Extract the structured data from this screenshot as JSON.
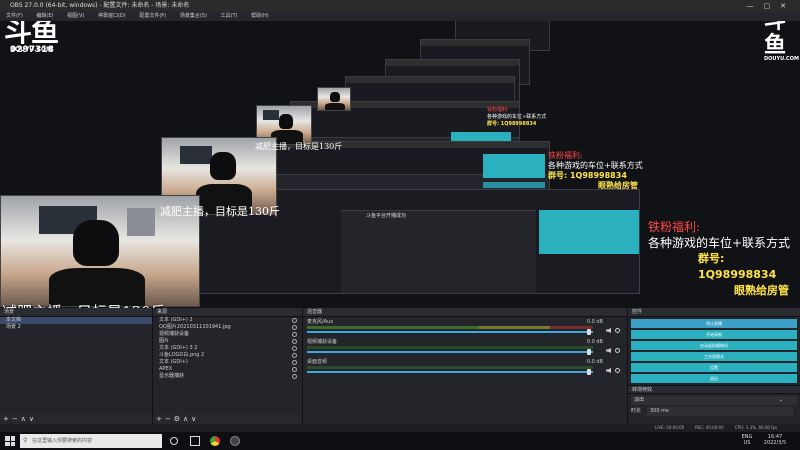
{
  "window": {
    "title": "OBS 27.0.0 (64-bit, windows) - 配置文件: 未命名 - 场景: 未命名"
  },
  "menu": [
    "文件(F)",
    "编辑(E)",
    "视图(V)",
    "停靠窗口(D)",
    "配置文件(P)",
    "场景集合(S)",
    "工具(T)",
    "帮助(H)"
  ],
  "overlay": {
    "logo_text": "斗鱼",
    "logo_sub": "DOUYU.COM",
    "room_id": "9297318",
    "fan_title": "铁粉福利:",
    "fan_desc": "各种游戏的车位+联系方式",
    "group_label": "群号: 1Q98998834",
    "group_sub": "眼熟给房管",
    "caption": "减肥主播，目标是130斤",
    "nested_toast": "斗鱼平台开播成功"
  },
  "scenes": {
    "header": "场景",
    "items": [
      "本文档",
      "场景 2"
    ]
  },
  "sources": {
    "header": "来源",
    "items": [
      {
        "label": "文本 (GDI+) 2"
      },
      {
        "label": "QQ图片20210311101941.jpg"
      },
      {
        "label": "视频捕获设备"
      },
      {
        "label": "图片"
      },
      {
        "label": "文本 (GDI+) 3 2"
      },
      {
        "label": "斗鱼LOGO白.png 2"
      },
      {
        "label": "文本 (GDI+)"
      },
      {
        "label": "APEX"
      },
      {
        "label": "显示器捕获"
      }
    ]
  },
  "mixer": {
    "header": "混音器",
    "channels": [
      {
        "name": "桌面音频",
        "db": "0.0 dB"
      },
      {
        "name": "视频捕获设备",
        "db": "0.0 dB"
      },
      {
        "name": "麦克风/Aux",
        "db": "0.0 dB"
      }
    ]
  },
  "controls": {
    "header": "控件",
    "buttons": [
      "停止直播",
      "开始录制",
      "启动虚拟摄像机",
      "工作室模式",
      "设置",
      "退出"
    ]
  },
  "transitions": {
    "header": "转场特效",
    "type": "淡出",
    "duration_label": "时长",
    "duration_value": "300 ms"
  },
  "status": {
    "live": "LIVE: 00:00:00",
    "rec": "REC: 00:00:00",
    "cpu": "CPU: 1.3%, 60.00 fps"
  },
  "taskbar": {
    "search_placeholder": "在这里输入你要搜索的内容",
    "lang": "ENG",
    "region": "US",
    "time": "16:47",
    "date": "2022/3/5"
  }
}
